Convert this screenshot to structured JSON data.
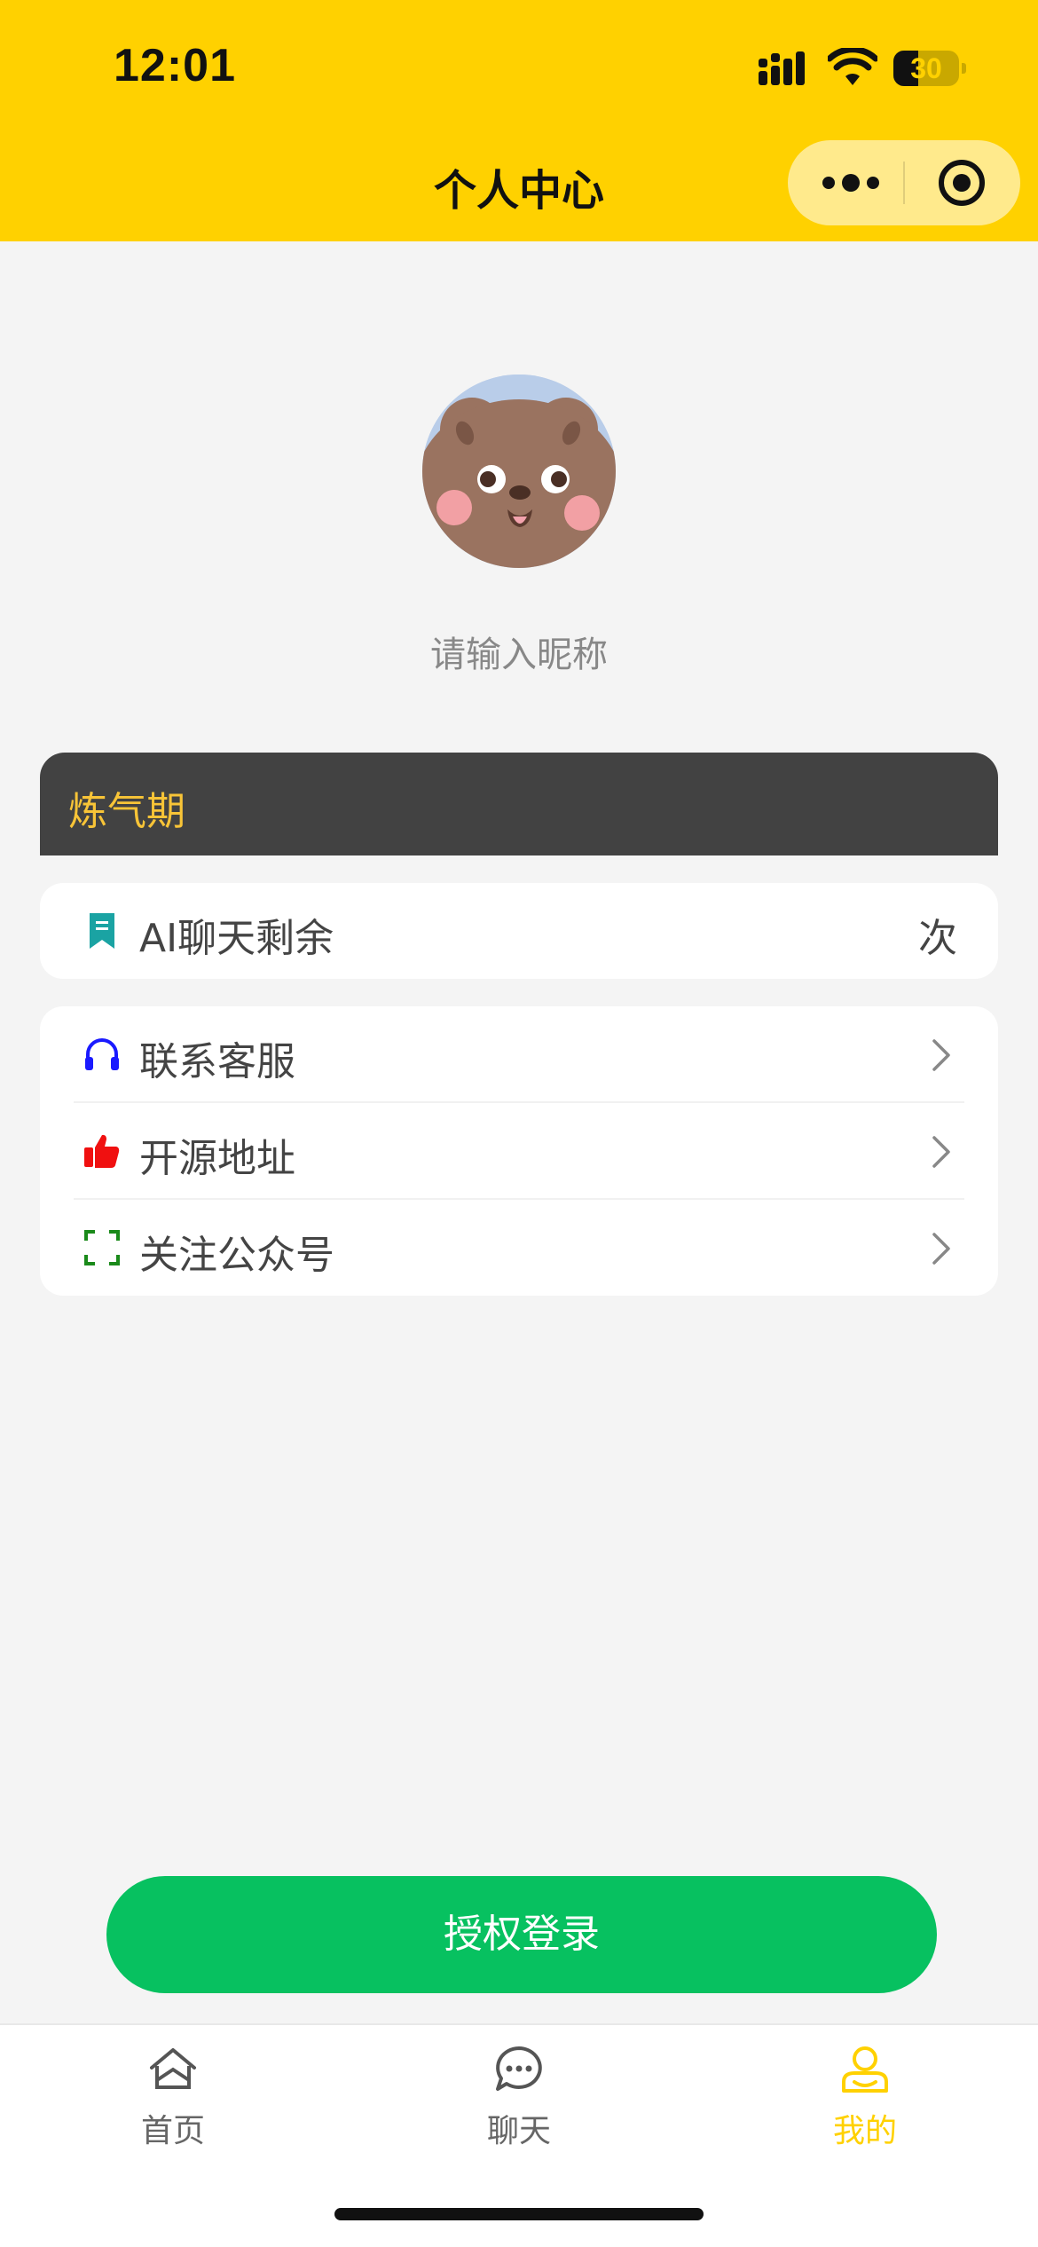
{
  "status_bar": {
    "time": "12:01",
    "battery": "30"
  },
  "header": {
    "title": "个人中心"
  },
  "profile": {
    "nickname_placeholder": "请输入昵称"
  },
  "level": {
    "name": "炼气期"
  },
  "quota": {
    "label": "AI聊天剩余",
    "unit": "次"
  },
  "menu": {
    "items": [
      {
        "label": "联系客服",
        "icon": "headset-icon",
        "color": "#1a1aff"
      },
      {
        "label": "开源地址",
        "icon": "thumbs-up-icon",
        "color": "#f01010"
      },
      {
        "label": "关注公众号",
        "icon": "scan-icon",
        "color": "#1a8a1a"
      }
    ]
  },
  "login_button": "授权登录",
  "tabbar": {
    "items": [
      {
        "label": "首页",
        "icon": "home-icon"
      },
      {
        "label": "聊天",
        "icon": "chat-icon"
      },
      {
        "label": "我的",
        "icon": "user-icon",
        "active": true
      }
    ]
  },
  "colors": {
    "header_bg": "#ffd100",
    "login_green": "#07c160",
    "level_bg": "#424242",
    "level_text": "#f8c437",
    "quota_icon": "#1aa3a3"
  }
}
